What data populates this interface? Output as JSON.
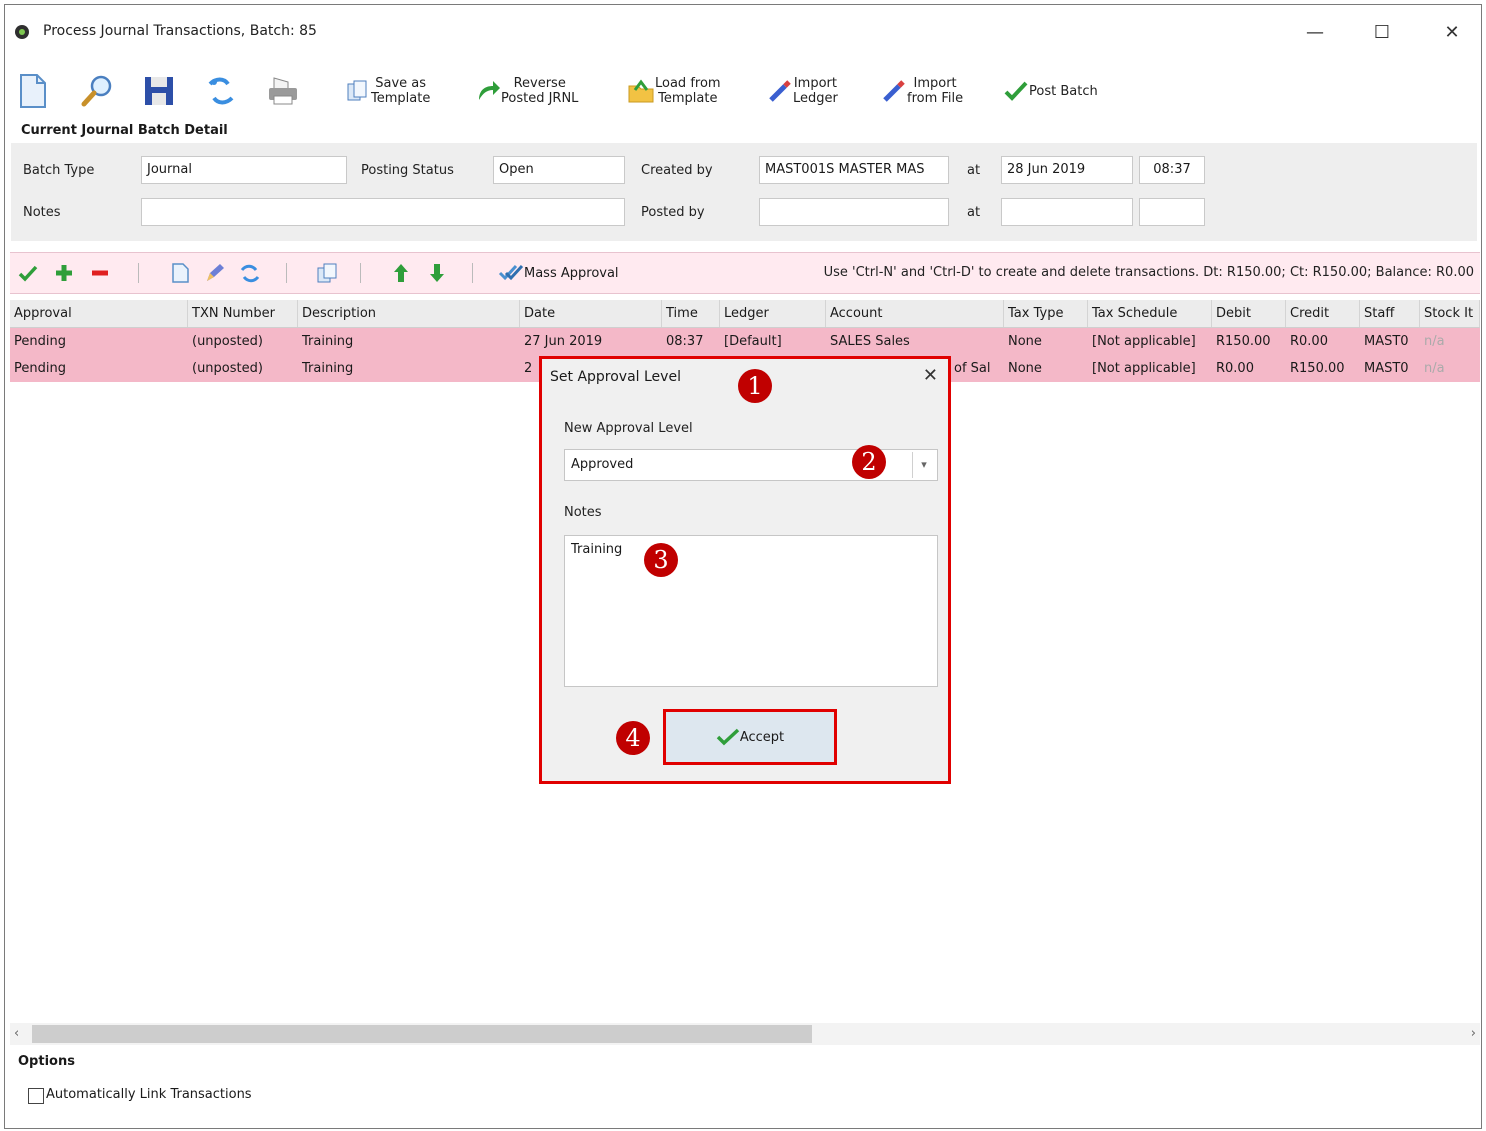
{
  "window": {
    "title": "Process Journal Transactions, Batch: 85",
    "minimize": "—",
    "maximize": "☐",
    "close": "✕"
  },
  "toolbar": {
    "save_as_template": "Save as\nTemplate",
    "reverse_posted": "Reverse\nPosted JRNL",
    "load_from_template": "Load from\nTemplate",
    "import_ledger": "Import\nLedger",
    "import_from_file": "Import\nfrom File",
    "post_batch": "Post Batch"
  },
  "detail": {
    "section_title": "Current Journal Batch Detail",
    "batch_type_label": "Batch Type",
    "batch_type_value": "Journal",
    "posting_status_label": "Posting Status",
    "posting_status_value": "Open",
    "created_by_label": "Created by",
    "created_by_value": "MAST001S MASTER MAS",
    "at_label": "at",
    "created_date": "28 Jun 2019",
    "created_time": "08:37",
    "notes_label": "Notes",
    "notes_value": "",
    "posted_by_label": "Posted by",
    "posted_by_value": "",
    "posted_at_label": "at",
    "posted_date": "",
    "posted_time": ""
  },
  "grid_toolbar": {
    "mass_approval": "Mass Approval",
    "info": "Use 'Ctrl-N' and 'Ctrl-D' to create and delete transactions. Dt: R150.00; Ct: R150.00; Balance: R0.00"
  },
  "grid": {
    "columns": [
      "Approval",
      "TXN Number",
      "Description",
      "Date",
      "Time",
      "Ledger",
      "Account",
      "Tax Type",
      "Tax Schedule",
      "Debit",
      "Credit",
      "Staff",
      "Stock It"
    ],
    "rows": [
      [
        "Pending",
        "(unposted)",
        "Training",
        "27 Jun 2019",
        "08:37",
        "[Default]",
        "SALES Sales",
        "None",
        "[Not applicable]",
        "R150.00",
        "R0.00",
        "MAST0",
        "n/a"
      ],
      [
        "Pending",
        "(unposted)",
        "Training",
        "2",
        "",
        "",
        "of Sal",
        "None",
        "[Not applicable]",
        "R0.00",
        "R150.00",
        "MAST0",
        "n/a"
      ]
    ]
  },
  "scroll": {
    "left": "‹",
    "right": "›"
  },
  "options": {
    "title": "Options",
    "auto_link": "Automatically Link Transactions"
  },
  "dialog": {
    "title": "Set Approval Level",
    "close": "✕",
    "level_label": "New Approval Level",
    "level_value": "Approved",
    "notes_label": "Notes",
    "notes_value": "Training",
    "accept": "Accept"
  },
  "badges": [
    "1",
    "2",
    "3",
    "4"
  ],
  "colors": {
    "row_highlight": "#f4b8c8",
    "grid_bar": "#ffeaf0",
    "annotation_red": "#e00000",
    "badge_red": "#c00000"
  }
}
